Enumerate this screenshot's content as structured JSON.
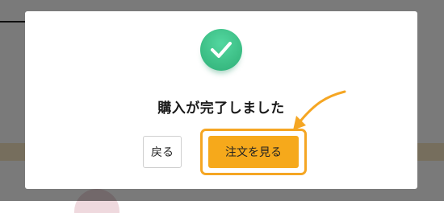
{
  "dialog": {
    "title": "購入が完了しました",
    "icon": "check-circle-icon",
    "back_label": "戻る",
    "view_order_label": "注文を見る"
  },
  "colors": {
    "success_green": "#3dbf86",
    "primary_orange": "#f6a91b",
    "highlight_orange": "#f5a623"
  }
}
